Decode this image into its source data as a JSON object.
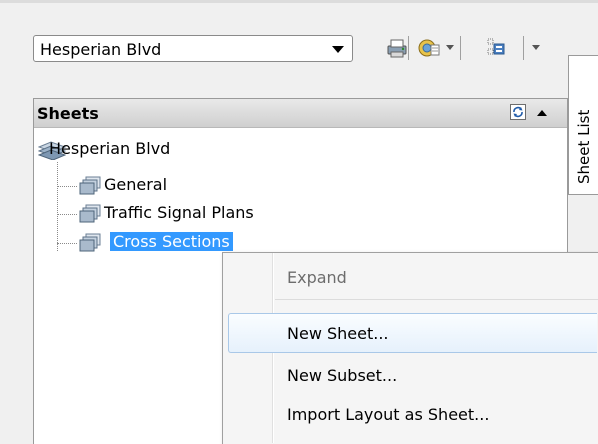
{
  "toolbar": {
    "sheet_set_value": "Hesperian Blvd",
    "publish_button": "publish-to-plotter-icon",
    "sheet_set_manager_button": "sheet-set-manager-icon",
    "model_view_button": "model-view-icon"
  },
  "side_tab": {
    "label": "Sheet List"
  },
  "panel": {
    "title": "Sheets"
  },
  "tree": {
    "root": "Hesperian Blvd",
    "children": [
      "General",
      "Traffic Signal Plans",
      "Cross Sections"
    ]
  },
  "context_menu": {
    "items": [
      "Expand",
      "New Sheet...",
      "New Subset...",
      "Import Layout as Sheet..."
    ]
  },
  "colors": {
    "selection": "#3399ff",
    "hover": "#e6f1fc"
  }
}
